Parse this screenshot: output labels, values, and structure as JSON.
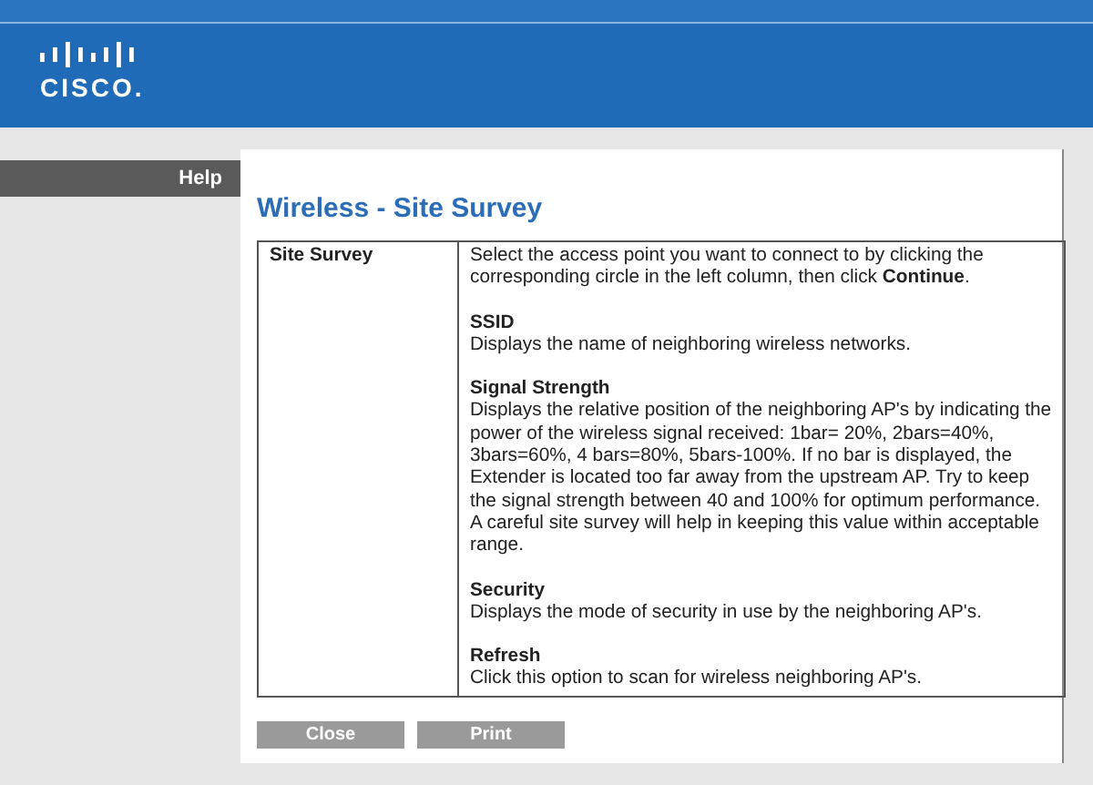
{
  "header": {
    "logo": "CISCO."
  },
  "sidebar": {
    "help": "Help"
  },
  "title": "Wireless - Site Survey",
  "help_table": {
    "label": "Site Survey",
    "intro": "Select the access point you want to connect to by clicking the corresponding circle in the left column, then click **Continue**.",
    "sections": [
      {
        "heading": "SSID",
        "text": "Displays the name of neighboring wireless networks."
      },
      {
        "heading": "Signal Strength",
        "text": "Displays the relative position of the neighboring AP's by indicating the power of the wireless signal received: 1bar= 20%, 2bars=40%, 3bars=60%, 4 bars=80%, 5bars-100%. If no bar is displayed, the Extender is located too far away from the upstream AP. Try to keep the signal strength between 40 and 100% for optimum performance. A careful site survey will help in keeping this value within acceptable range."
      },
      {
        "heading": "Security",
        "text": "Displays the mode of security in use by the neighboring AP's."
      },
      {
        "heading": "Refresh",
        "text": "Click this option to scan for wireless neighboring AP's."
      }
    ]
  },
  "buttons": [
    "Close",
    "Print"
  ]
}
